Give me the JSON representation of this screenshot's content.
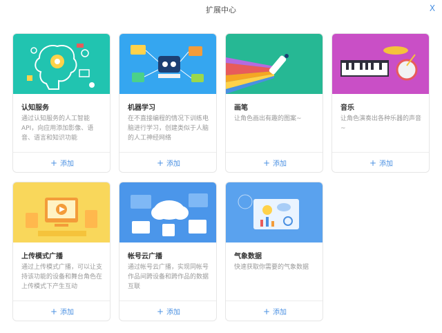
{
  "dialog": {
    "title": "扩展中心",
    "close_label": "X"
  },
  "cards": [
    {
      "name": "认知服务",
      "desc": "通过认知服务的人工智能API，向应用添加影像、语音、语言和知识功能",
      "add": "添加",
      "bg": "#21c4b0"
    },
    {
      "name": "机器学习",
      "desc": "在不直接编程的情况下训练电脑进行学习，创建类似于人脑的人工神经网络",
      "add": "添加",
      "bg": "#35a6f0"
    },
    {
      "name": "画笔",
      "desc": "让角色画出有趣的图案~",
      "add": "添加",
      "bg": "#26b894"
    },
    {
      "name": "音乐",
      "desc": "让角色演奏出各种乐器的声音~",
      "add": "添加",
      "bg": "#c94fc6"
    },
    {
      "name": "上传模式广播",
      "desc": "通过上传模式广播，可以让支持该功能的设备和舞台角色在上传模式下产生互动",
      "add": "添加",
      "bg": "#f9d75b"
    },
    {
      "name": "帐号云广播",
      "desc": "通过帐号云广播，实现同帐号作品间跨设备和跨作品的数据互联",
      "add": "添加",
      "bg": "#4b96ea"
    },
    {
      "name": "气象数据",
      "desc": "快速获取你需要的气象数据",
      "add": "添加",
      "bg": "#5aa2ee"
    }
  ]
}
